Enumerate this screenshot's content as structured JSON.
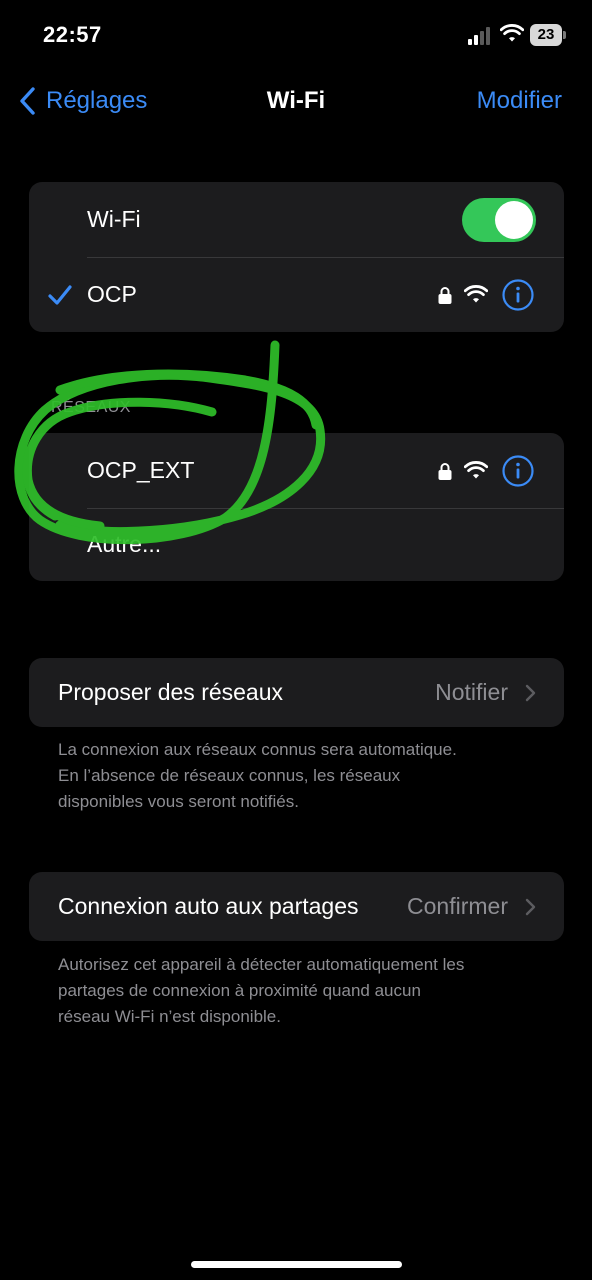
{
  "status_bar": {
    "time": "22:57",
    "battery": "23"
  },
  "nav": {
    "back_label": "Réglages",
    "title": "Wi-Fi",
    "edit_label": "Modifier"
  },
  "wifi_group": {
    "toggle_label": "Wi-Fi",
    "toggle_on": true,
    "connected_network": "OCP"
  },
  "networks": {
    "header": "RÉSEAUX",
    "items": [
      {
        "label": "OCP_EXT",
        "locked": true
      },
      {
        "label": "Autre..."
      }
    ]
  },
  "ask_to_join": {
    "label": "Proposer des réseaux",
    "value": "Notifier",
    "footnote_lines": [
      "La connexion aux réseaux connus sera automatique.",
      "En l’absence de réseaux connus, les réseaux",
      "disponibles vous seront notifiés."
    ]
  },
  "auto_join_hotspot": {
    "label": "Connexion auto aux partages",
    "value": "Confirmer",
    "footnote_lines": [
      "Autorisez cet appareil à détecter automatiquement les",
      "partages de connexion à proximité quand aucun",
      "réseau Wi-Fi n’est disponible."
    ]
  },
  "colors": {
    "accent": "#3b8bf6",
    "toggle_on": "#34c759",
    "annotation": "#2fbf2a",
    "cell_background": "#1c1c1e",
    "secondary_text": "#8e8e93"
  },
  "icons": [
    "signal-icon",
    "wifi-icon",
    "battery-icon",
    "back-chevron-icon",
    "checkmark-icon",
    "lock-icon",
    "info-icon",
    "chevron-right-icon"
  ]
}
